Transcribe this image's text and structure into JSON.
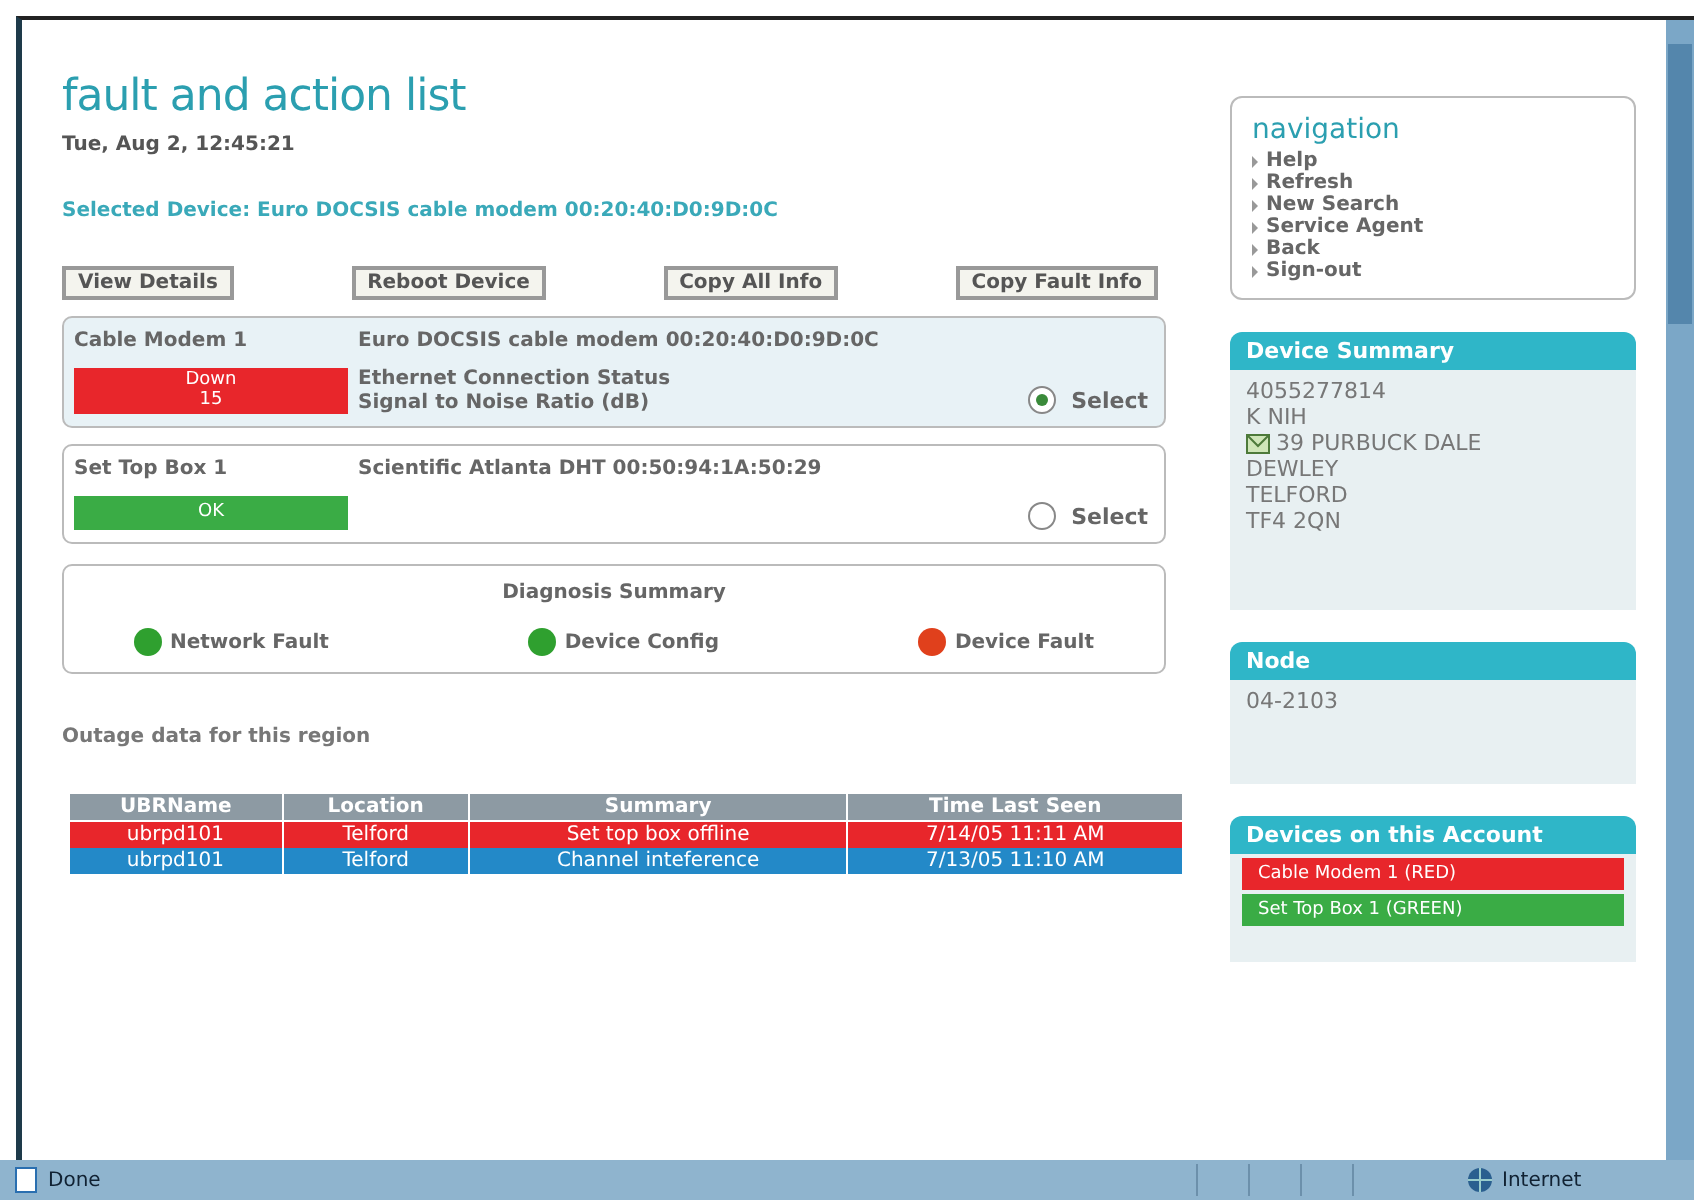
{
  "title": "fault and action list",
  "datetime": "Tue, Aug 2, 12:45:21",
  "selected_device": "Selected Device: Euro DOCSIS cable modem 00:20:40:D0:9D:0C",
  "buttons": [
    "View Details",
    "Reboot Device",
    "Copy All Info",
    "Copy Fault Info"
  ],
  "devices": [
    {
      "name": "Cable Modem 1",
      "description": "Euro DOCSIS cable modem 00:20:40:D0:9D:0C",
      "status_lines": [
        "Down",
        "15"
      ],
      "color": "#e8262b",
      "details": [
        "Ethernet Connection Status",
        "Signal to Noise Ratio (dB)"
      ],
      "select_label": "Select",
      "selected": true
    },
    {
      "name": "Set Top Box 1",
      "description": "Scientific Atlanta DHT 00:50:94:1A:50:29",
      "status_lines": [
        "OK"
      ],
      "color": "#3aac45",
      "select_label": "Select",
      "selected": false
    }
  ],
  "diagnosis": {
    "title": "Diagnosis Summary",
    "items": [
      {
        "label": "Network Fault",
        "color": "#2fa02f"
      },
      {
        "label": "Device Config",
        "color": "#2fa02f"
      },
      {
        "label": "Device Fault",
        "color": "#e0401c"
      }
    ]
  },
  "outage": {
    "title": "Outage data for this region",
    "columns": [
      "UBRName",
      "Location",
      "Summary",
      "Time Last Seen"
    ],
    "rows": [
      {
        "color": "#e8262b",
        "cells": [
          "ubrpd101",
          "Telford",
          "Set top box offline",
          "7/14/05 11:11 AM"
        ]
      },
      {
        "color": "#2389c8",
        "cells": [
          "ubrpd101",
          "Telford",
          "Channel inteference",
          "7/13/05 11:10 AM"
        ]
      }
    ]
  },
  "navigation": {
    "title": "navigation",
    "items": [
      "Help",
      "Refresh",
      "New Search",
      "Service Agent",
      "Back",
      "Sign-out"
    ]
  },
  "device_summary": {
    "title": "Device Summary",
    "lines": [
      "4055277814",
      "K NIH",
      "39 PURBUCK DALE",
      "DEWLEY",
      "TELFORD",
      "TF4 2QN"
    ]
  },
  "node": {
    "title": "Node",
    "value": "04-2103"
  },
  "account_devices": {
    "title": "Devices on this Account",
    "items": [
      {
        "label": "Cable Modem 1 (RED)",
        "color": "#e8262b"
      },
      {
        "label": "Set Top Box 1 (GREEN)",
        "color": "#3aac45"
      }
    ]
  },
  "status_bar": {
    "left": "Done",
    "zone": "Internet"
  }
}
